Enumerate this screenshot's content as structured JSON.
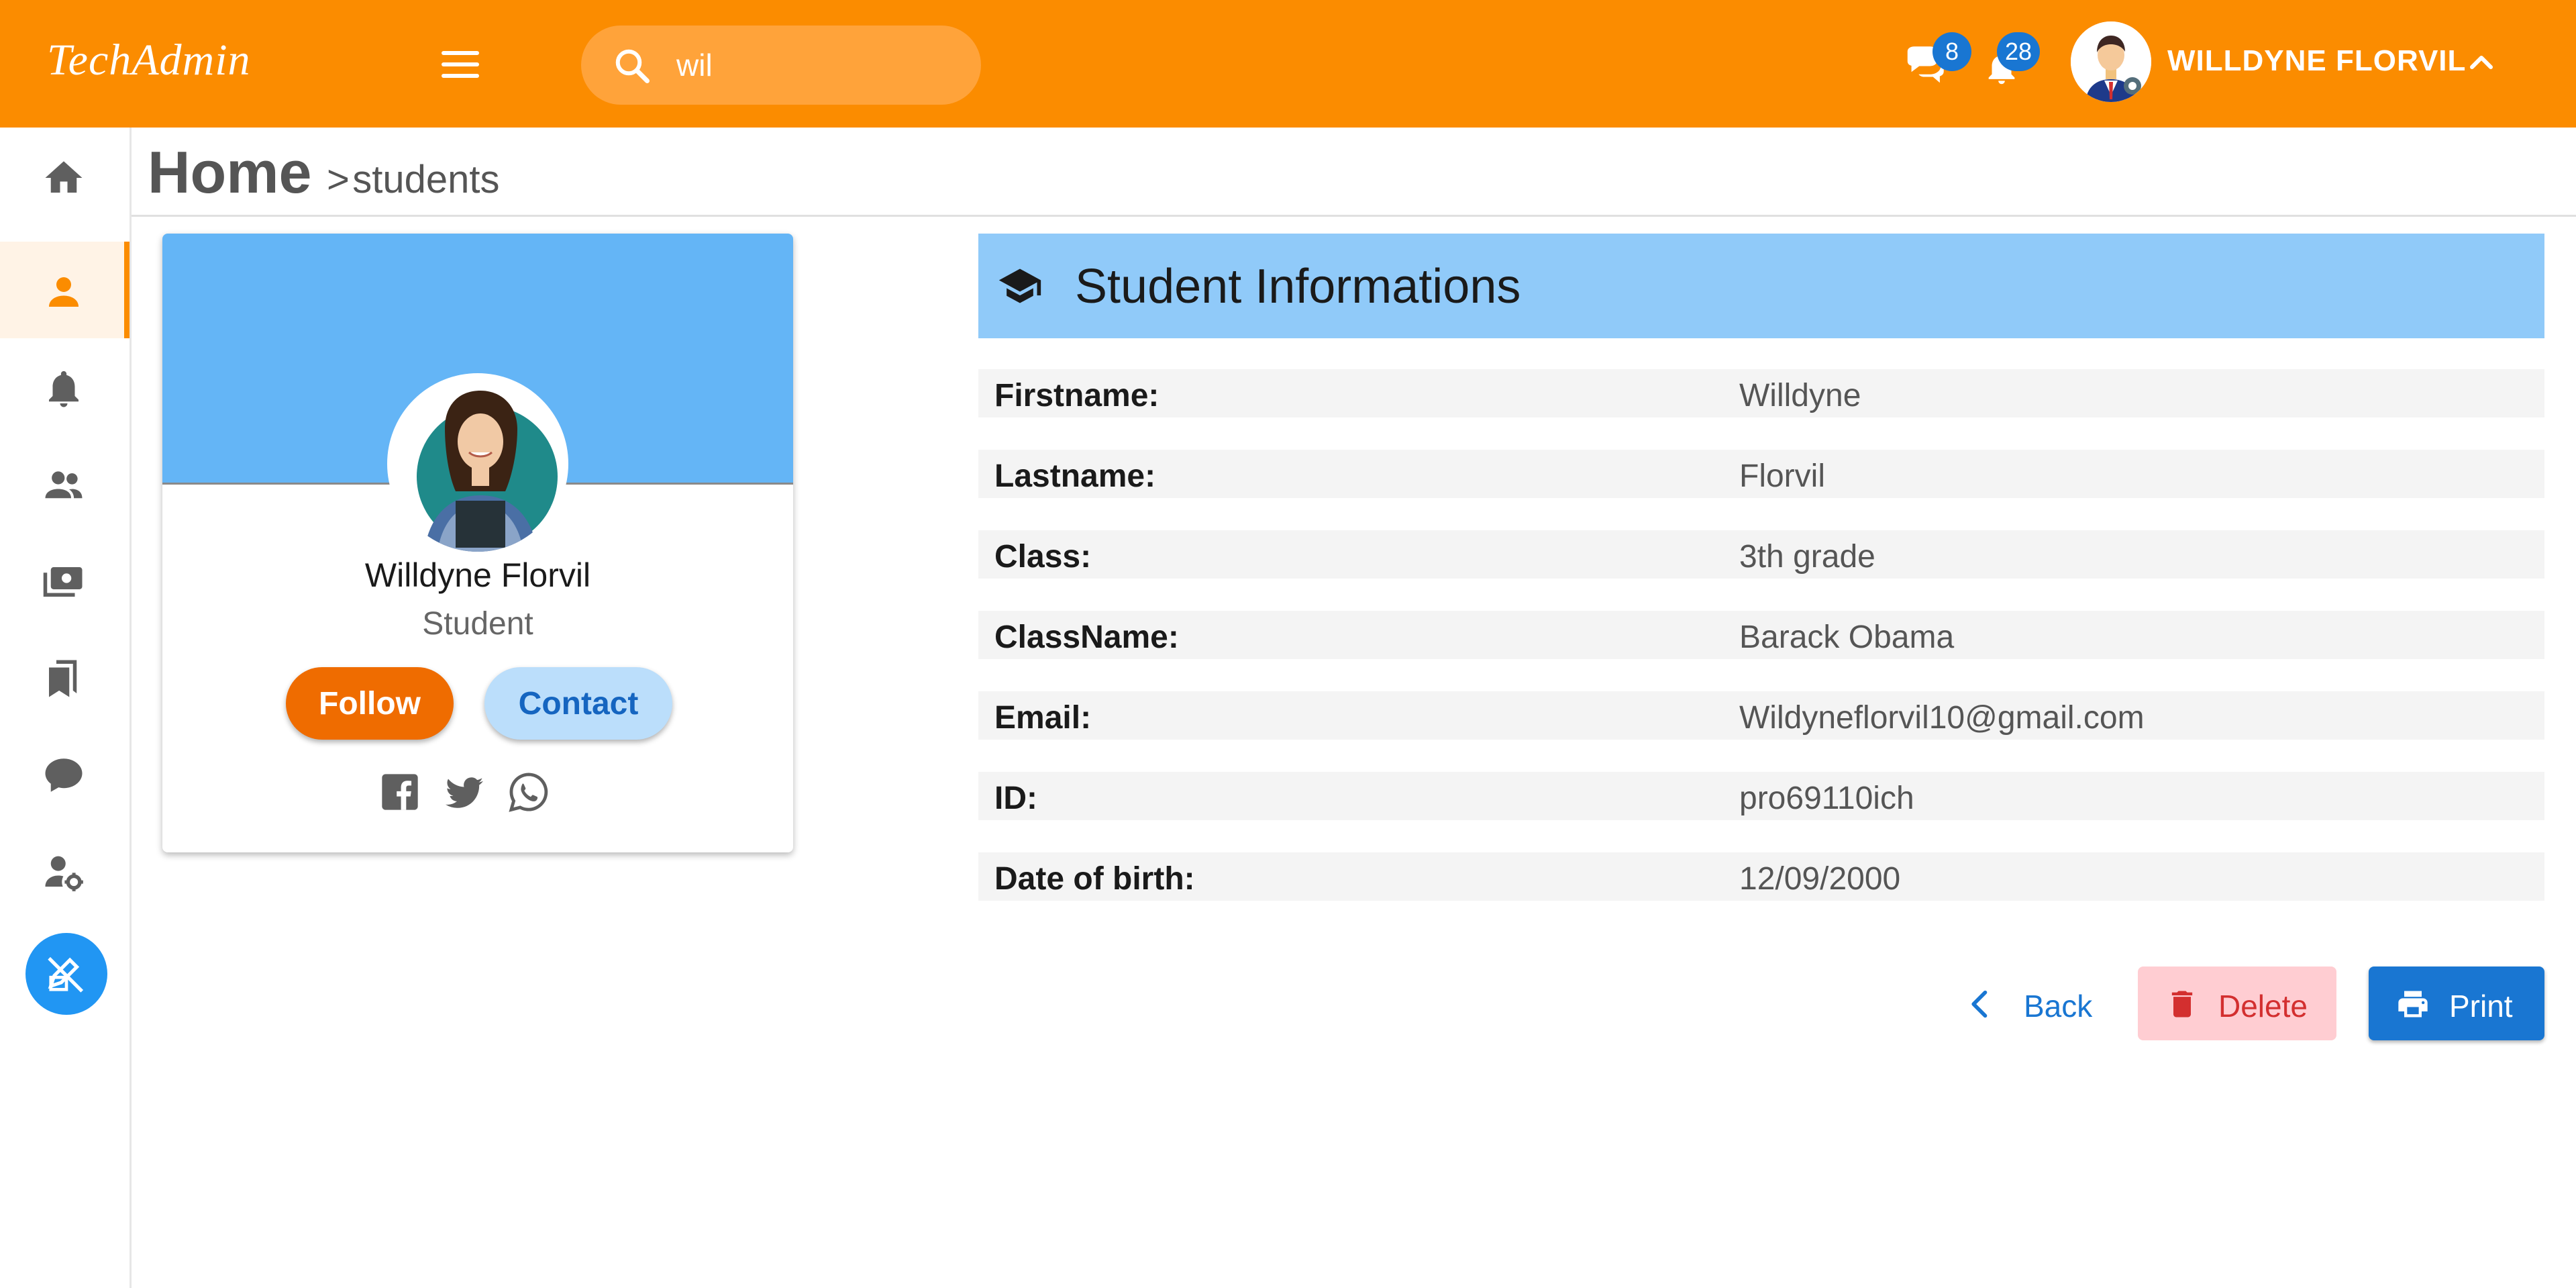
{
  "app": {
    "brand": "TechAdmin",
    "accent_color": "#fb8c00"
  },
  "search": {
    "value": "wil",
    "placeholder": "Search"
  },
  "notifications": {
    "messages_count": "8",
    "alerts_count": "28"
  },
  "user": {
    "name": "WILLDYNE FLORVIL"
  },
  "sidebar": {
    "items": [
      {
        "icon": "home-icon"
      },
      {
        "icon": "person-icon",
        "active": true
      },
      {
        "icon": "bell-icon"
      },
      {
        "icon": "people-icon"
      },
      {
        "icon": "payments-icon"
      },
      {
        "icon": "bookmarks-icon"
      },
      {
        "icon": "chat-icon"
      },
      {
        "icon": "user-settings-icon"
      },
      {
        "icon": "edit-off-icon"
      }
    ]
  },
  "breadcrumb": {
    "home": "Home",
    "separator": ">",
    "current": "students"
  },
  "profile": {
    "name": "Willdyne Florvil",
    "role": "Student",
    "follow_label": "Follow",
    "contact_label": "Contact",
    "socials": [
      "facebook-icon",
      "twitter-icon",
      "whatsapp-icon"
    ]
  },
  "student_info": {
    "title": "Student Informations",
    "rows": [
      {
        "label": "Firstname:",
        "value": "Willdyne"
      },
      {
        "label": "Lastname:",
        "value": "Florvil"
      },
      {
        "label": "Class:",
        "value": "3th grade"
      },
      {
        "label": "ClassName:",
        "value": "Barack Obama"
      },
      {
        "label": "Email:",
        "value": "Wildyneflorvil10@gmail.com"
      },
      {
        "label": "ID:",
        "value": "pro69110ich"
      },
      {
        "label": "Date of birth:",
        "value": "12/09/2000"
      }
    ]
  },
  "actions": {
    "back_label": "Back",
    "delete_label": "Delete",
    "print_label": "Print"
  }
}
